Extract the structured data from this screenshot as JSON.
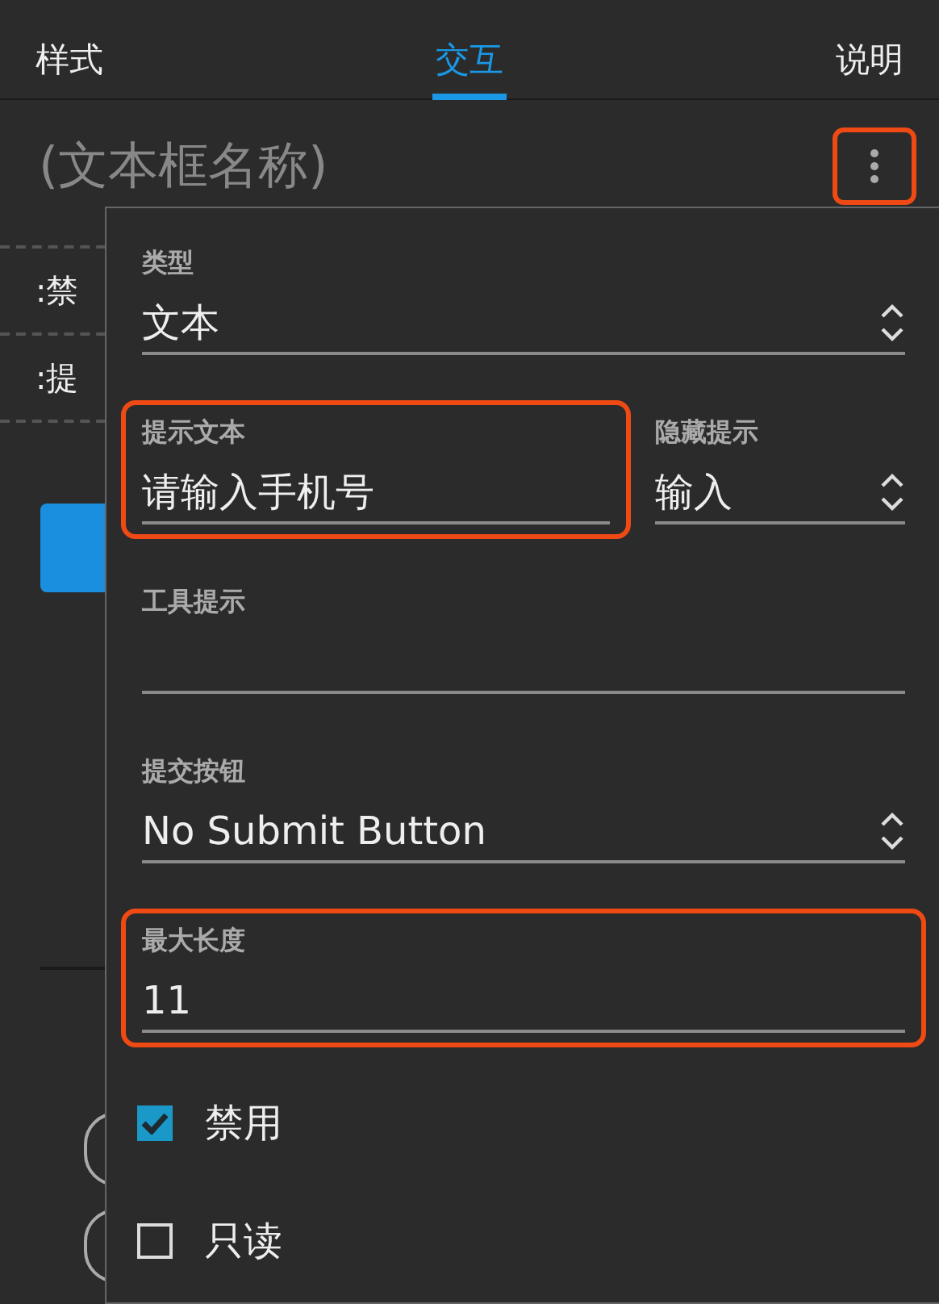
{
  "tabs": [
    {
      "label": "样式",
      "selected": false
    },
    {
      "label": "交互",
      "selected": true
    },
    {
      "label": "说明",
      "selected": false
    }
  ],
  "title": "(文本框名称)",
  "menu_button": {
    "highlighted": true
  },
  "background_rows": [
    ":禁",
    ":提"
  ],
  "popup": {
    "rows": [
      {
        "fields": [
          {
            "kind": "select",
            "label": "类型",
            "value": "文本",
            "highlighted": false
          }
        ]
      },
      {
        "fields": [
          {
            "kind": "text",
            "label": "提示文本",
            "value": "请输入手机号",
            "highlighted": true
          },
          {
            "kind": "select",
            "label": "隐藏提示",
            "value": "输入",
            "highlighted": false
          }
        ]
      },
      {
        "fields": [
          {
            "kind": "text",
            "label": "工具提示",
            "highlighted": false
          }
        ]
      },
      {
        "fields": [
          {
            "kind": "select",
            "label": "提交按钮",
            "value": "No Submit Button",
            "highlighted": false
          }
        ]
      },
      {
        "fields": [
          {
            "kind": "text",
            "label": "最大长度",
            "value": "11",
            "highlighted": true
          }
        ]
      },
      {
        "fields": [
          {
            "kind": "checkbox",
            "label": "禁用",
            "checked": true
          }
        ]
      },
      {
        "fields": [
          {
            "kind": "checkbox",
            "label": "只读",
            "checked": false
          }
        ]
      }
    ]
  }
}
